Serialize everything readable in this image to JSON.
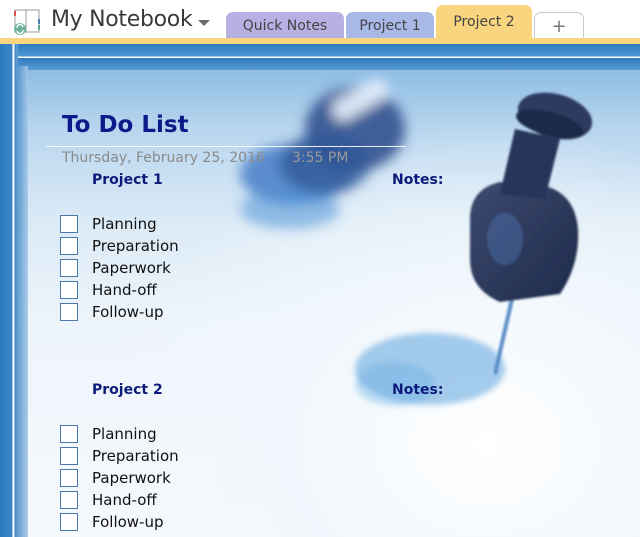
{
  "header": {
    "notebook_name": "My Notebook",
    "notebook_icon": "notebook-sync-icon",
    "dropdown_icon": "chevron-down-icon"
  },
  "tabs": [
    {
      "label": "Quick Notes",
      "color": "#b7b0e2",
      "active": false
    },
    {
      "label": "Project 1",
      "color": "#a8b9e8",
      "active": false
    },
    {
      "label": "Project 2",
      "color": "#f8d57e",
      "active": true
    },
    {
      "label": "+",
      "color": "#ffffff",
      "active": false,
      "icon": "add-section-icon"
    }
  ],
  "page": {
    "title": "To Do List",
    "date": "Thursday, February 25, 2016",
    "time": "3:55 PM",
    "background": "pushpins-image",
    "sections": [
      {
        "heading": "Project 1",
        "notes_label": "Notes:",
        "items": [
          {
            "label": "Planning",
            "checked": false
          },
          {
            "label": "Preparation",
            "checked": false
          },
          {
            "label": "Paperwork",
            "checked": false
          },
          {
            "label": "Hand-off",
            "checked": false
          },
          {
            "label": "Follow-up",
            "checked": false
          }
        ]
      },
      {
        "heading": "Project 2",
        "notes_label": "Notes:",
        "items": [
          {
            "label": "Planning",
            "checked": false
          },
          {
            "label": "Preparation",
            "checked": false
          },
          {
            "label": "Paperwork",
            "checked": false
          },
          {
            "label": "Hand-off",
            "checked": false
          },
          {
            "label": "Follow-up",
            "checked": false
          }
        ]
      }
    ]
  },
  "colors": {
    "title": "#0c1a8a",
    "heading": "#0c1a7a",
    "active_tab": "#f8d57e",
    "frame_blue": "#2e7cc0"
  }
}
